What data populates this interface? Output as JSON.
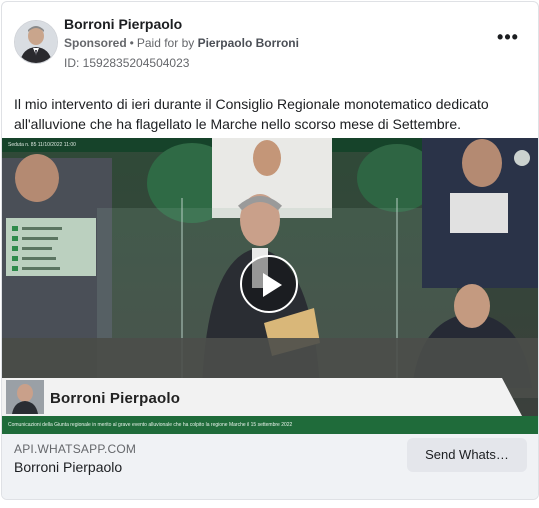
{
  "ad": {
    "page_name": "Borroni Pierpaolo",
    "sponsored_label": "Sponsored",
    "separator": "•",
    "paid_for_prefix": "Paid for by",
    "payer_name": "Pierpaolo Borroni",
    "library_id": "ID: 1592835204504023",
    "more_icon": "more-horizontal-icon",
    "more_label": "•••",
    "body_text": "Il mio intervento di ieri durante il Consiglio Regionale monotematico dedicato all'alluvione che ha flagellato le Marche nello scorso mese di Settembre."
  },
  "video": {
    "play_icon": "play-icon",
    "lower_third_name": "Borroni Pierpaolo",
    "session_label": "Seduta n. 85   11/10/2022   11:00",
    "ticker_text": "Comunicazioni della Giunta regionale in merito al grave evento alluvionale che ha colpito la regione Marche il 15 settembre 2022"
  },
  "link": {
    "domain": "API.WHATSAPP.COM",
    "title": "Borroni Pierpaolo",
    "cta_label": "Send Whats…"
  },
  "colors": {
    "card_border": "#dfe1e5",
    "footer_bg": "#f0f2f5",
    "cta_bg": "#e4e6eb",
    "secondary_text": "#65676b",
    "ticker_green": "#1f6b3a"
  }
}
